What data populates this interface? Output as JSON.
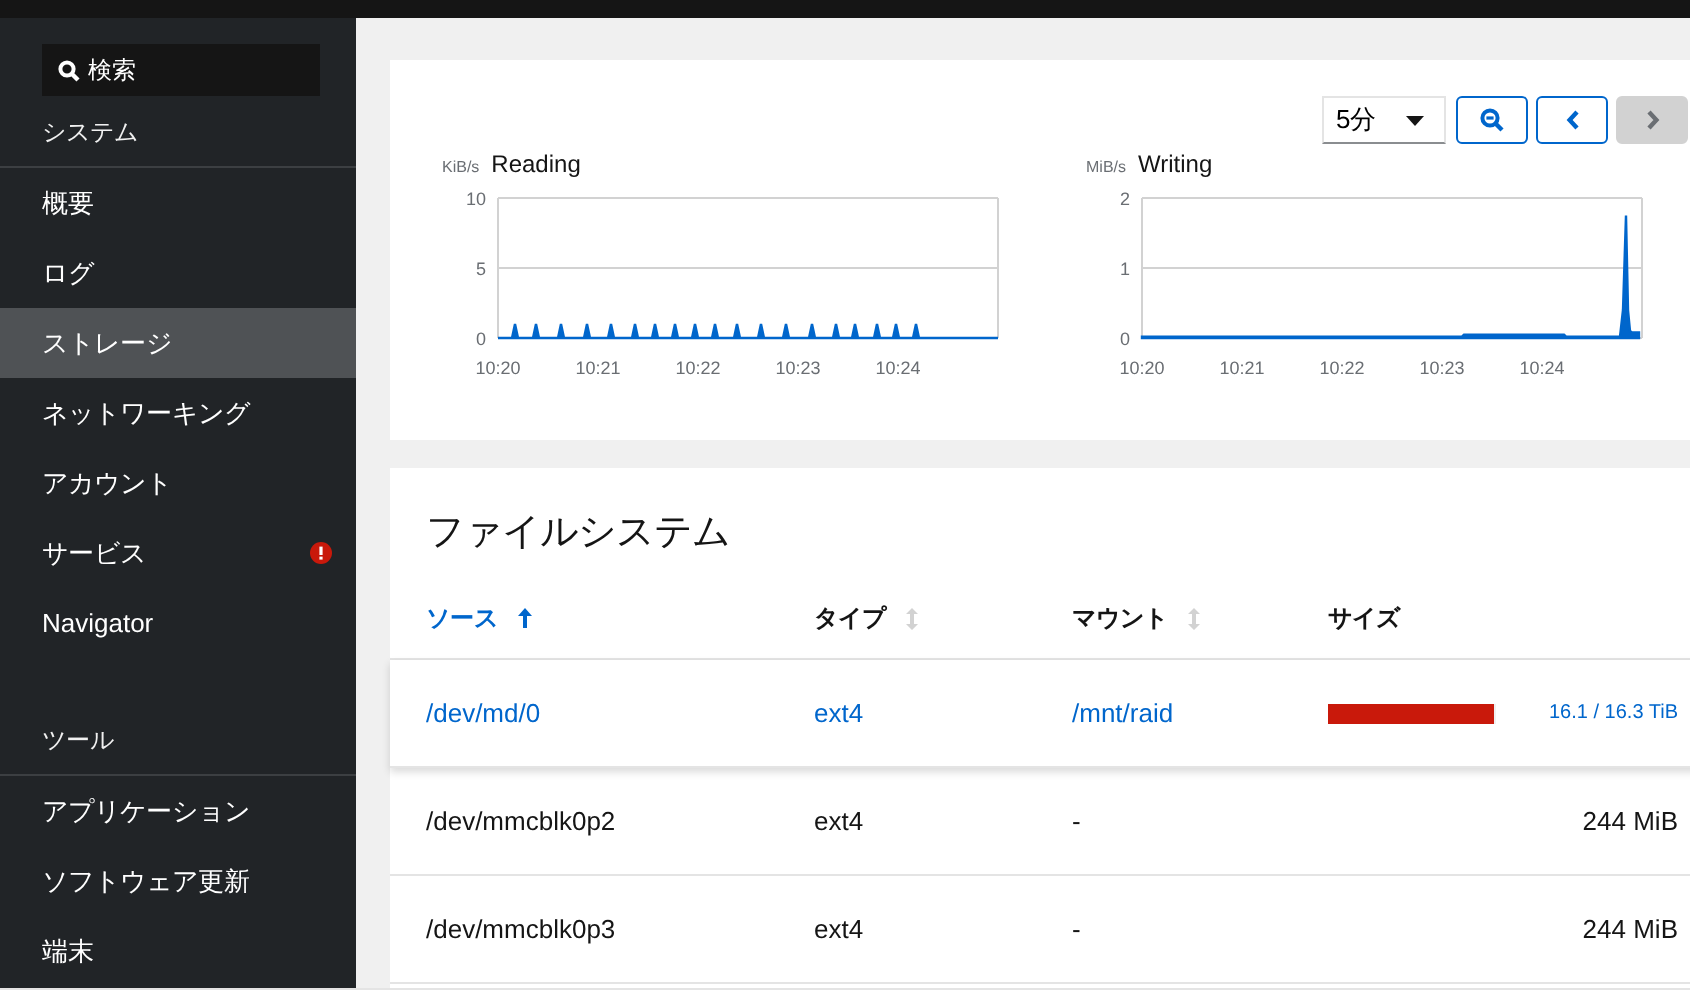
{
  "sidebar": {
    "search": {
      "placeholder": "検索"
    },
    "sections": [
      {
        "heading": "システム",
        "items": [
          {
            "label": "概要",
            "selected": false,
            "alert": false
          },
          {
            "label": "ログ",
            "selected": false,
            "alert": false
          },
          {
            "label": "ストレージ",
            "selected": true,
            "alert": false
          },
          {
            "label": "ネットワーキング",
            "selected": false,
            "alert": false
          },
          {
            "label": "アカウント",
            "selected": false,
            "alert": false
          },
          {
            "label": "サービス",
            "selected": false,
            "alert": true
          },
          {
            "label": "Navigator",
            "selected": false,
            "alert": false
          }
        ]
      },
      {
        "heading": "ツール",
        "items": [
          {
            "label": "アプリケーション",
            "selected": false,
            "alert": false
          },
          {
            "label": "ソフトウェア更新",
            "selected": false,
            "alert": false
          },
          {
            "label": "端末",
            "selected": false,
            "alert": false
          }
        ]
      }
    ]
  },
  "graphs": {
    "range": "5分",
    "next_disabled": true,
    "charts": [
      {
        "chart_data": {
          "type": "area",
          "ylabel": "KiB/s",
          "xlim": [
            620,
            625
          ],
          "ylim": [
            0,
            10
          ],
          "yticks": [
            0,
            5,
            10
          ],
          "xticks": [
            {
              "value": 620,
              "label": "10:20"
            },
            {
              "value": 621,
              "label": "10:21"
            },
            {
              "value": 622,
              "label": "10:22"
            },
            {
              "value": 623,
              "label": "10:23"
            },
            {
              "value": 624,
              "label": "10:24"
            }
          ],
          "x": [
            620,
            620.14,
            620.17,
            620.2,
            620.35,
            620.38,
            620.41,
            620.6,
            620.63,
            620.66,
            620.86,
            620.89,
            620.92,
            621.1,
            621.13,
            621.16,
            621.34,
            621.37,
            621.4,
            621.54,
            621.57,
            621.6,
            621.74,
            621.77,
            621.8,
            621.94,
            621.97,
            622.0,
            622.14,
            622.17,
            622.2,
            622.36,
            622.39,
            622.42,
            622.6,
            622.63,
            622.66,
            622.85,
            622.88,
            622.91,
            623.11,
            623.14,
            623.17,
            623.35,
            623.38,
            623.41,
            623.54,
            623.57,
            623.6,
            623.76,
            623.79,
            623.82,
            623.95,
            623.98,
            624.01,
            624.15,
            624.18,
            624.21,
            625
          ],
          "series": [
            {
              "name": "Reading",
              "color": "#0066cc",
              "values": [
                0,
                0,
                1,
                0,
                0,
                1,
                0,
                0,
                1,
                0,
                0,
                1,
                0,
                0,
                1,
                0,
                0,
                1,
                0,
                0,
                1,
                0,
                0,
                1,
                0,
                0,
                1,
                0,
                0,
                1,
                0,
                0,
                1,
                0,
                0,
                1,
                0,
                0,
                1,
                0,
                0,
                1,
                0,
                0,
                1,
                0,
                0,
                1,
                0,
                0,
                1,
                0,
                0,
                1,
                0,
                0,
                1,
                0,
                0
              ]
            }
          ]
        }
      },
      {
        "chart_data": {
          "type": "area",
          "ylabel": "MiB/s",
          "xlim": [
            620,
            625
          ],
          "ylim": [
            0,
            2
          ],
          "yticks": [
            0,
            1,
            2
          ],
          "xticks": [
            {
              "value": 620,
              "label": "10:20"
            },
            {
              "value": 621,
              "label": "10:21"
            },
            {
              "value": 622,
              "label": "10:22"
            },
            {
              "value": 623,
              "label": "10:23"
            },
            {
              "value": 624,
              "label": "10:24"
            }
          ],
          "x": [
            620,
            623.2,
            623.22,
            624.22,
            624.24,
            624.78,
            624.81,
            624.84,
            624.86,
            624.88,
            624.9,
            624.97
          ],
          "series": [
            {
              "name": "Writing",
              "color": "#0066cc",
              "values": [
                0.02,
                0.02,
                0.05,
                0.05,
                0.02,
                0.02,
                0.4,
                1.75,
                0.4,
                0.1,
                0.08,
                0.08
              ]
            }
          ]
        }
      }
    ]
  },
  "filesystems": {
    "title": "ファイルシステム",
    "columns": [
      {
        "label": "ソース",
        "sortable": true,
        "sorted": true
      },
      {
        "label": "タイプ",
        "sortable": true,
        "sorted": false
      },
      {
        "label": "マウント",
        "sortable": true,
        "sorted": false
      },
      {
        "label": "サイズ",
        "sortable": false,
        "sorted": false
      }
    ],
    "rows": [
      {
        "kind": "usage",
        "selected": true,
        "source": "/dev/md/0",
        "type": "ext4",
        "mount": "/mnt/raid",
        "level": 0.99,
        "size": "16.1 / 16.3 TiB"
      },
      {
        "kind": "size",
        "selected": false,
        "source": "/dev/mmcblk0p2",
        "type": "ext4",
        "mount": "-",
        "size": "244 MiB"
      },
      {
        "kind": "size",
        "selected": false,
        "source": "/dev/mmcblk0p3",
        "type": "ext4",
        "mount": "-",
        "size": "244 MiB"
      }
    ]
  }
}
